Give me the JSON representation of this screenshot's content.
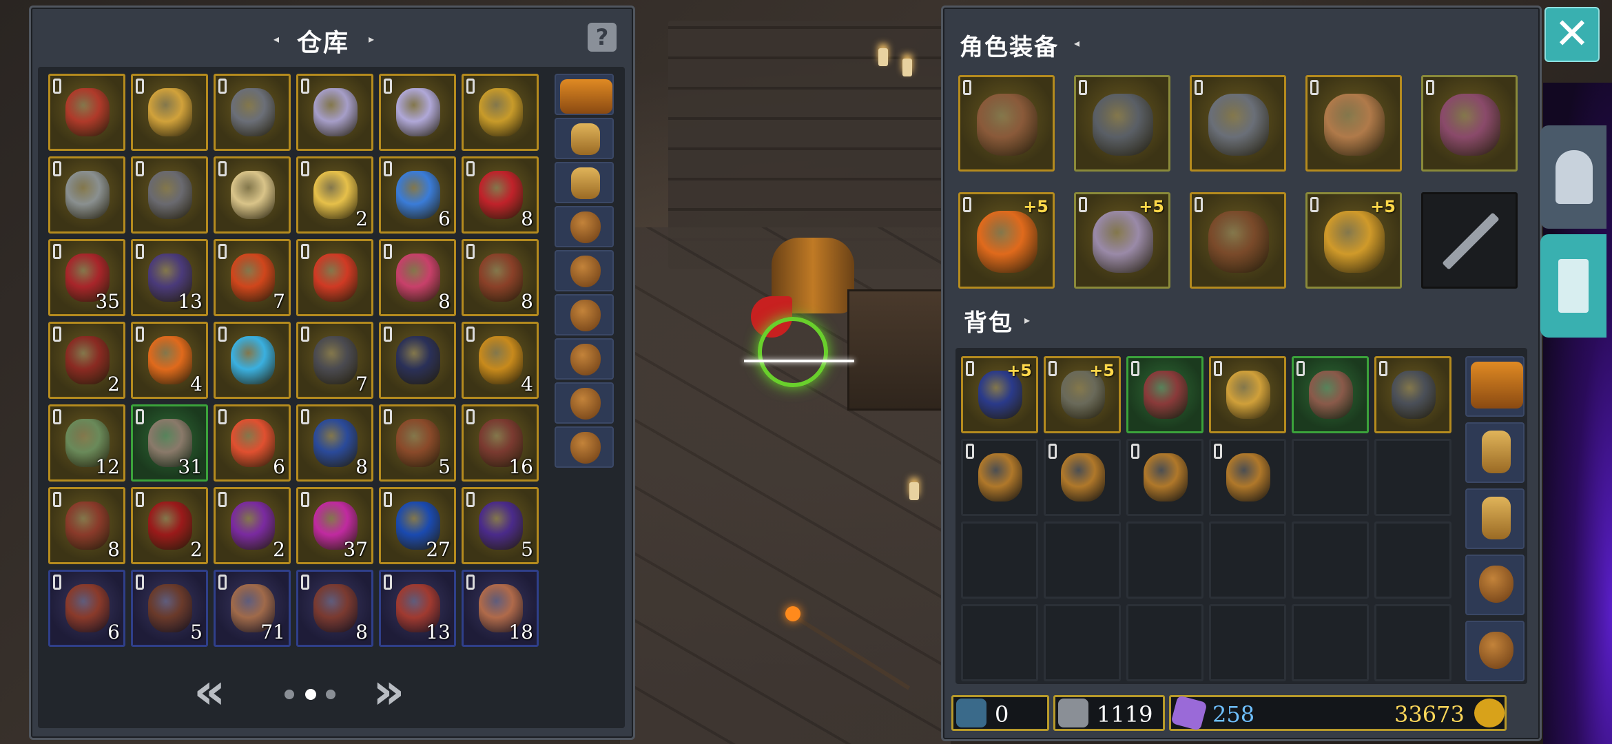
{
  "warehouse": {
    "title": "仓库",
    "help_label": "?",
    "prev_label": "«",
    "next_label": "»",
    "page_dots": 3,
    "current_page": 2,
    "grid": [
      [
        {
          "n": "",
          "c": "#b03a2a"
        },
        {
          "n": "",
          "c": "#d1a23b"
        },
        {
          "n": "",
          "c": "#6b6f78"
        },
        {
          "n": "",
          "c": "#a69ec8"
        },
        {
          "n": "",
          "c": "#b0a8d8"
        },
        {
          "n": "",
          "c": "#c89b2a"
        }
      ],
      [
        {
          "n": "",
          "c": "#8a9090"
        },
        {
          "n": "",
          "c": "#6a6a70"
        },
        {
          "n": "",
          "c": "#d9c489"
        },
        {
          "n": "2",
          "c": "#e6c04a"
        },
        {
          "n": "6",
          "c": "#3a7cd8"
        },
        {
          "n": "8",
          "c": "#c0222a"
        }
      ],
      [
        {
          "n": "35",
          "c": "#a8252a"
        },
        {
          "n": "13",
          "c": "#4a3a7a"
        },
        {
          "n": "7",
          "c": "#d0461c"
        },
        {
          "n": "",
          "c": "#d03a24"
        },
        {
          "n": "8",
          "c": "#c8406a"
        },
        {
          "n": "8",
          "c": "#8a4028"
        }
      ],
      [
        {
          "n": "2",
          "c": "#8a2a22"
        },
        {
          "n": "4",
          "c": "#e06a1c"
        },
        {
          "n": "",
          "c": "#3ab0e0"
        },
        {
          "n": "7",
          "c": "#4a4a50"
        },
        {
          "n": "",
          "c": "#2a3058"
        },
        {
          "n": "4",
          "c": "#c88a1c"
        }
      ],
      [
        {
          "n": "12",
          "c": "#6a8a5a"
        },
        {
          "n": "31",
          "c": "#8a7a6a"
        },
        {
          "n": "6",
          "c": "#e05030"
        },
        {
          "n": "8",
          "c": "#2a4a9a"
        },
        {
          "n": "5",
          "c": "#8a4a2a"
        },
        {
          "n": "16",
          "c": "#7a3a30"
        }
      ],
      [
        {
          "n": "8",
          "c": "#8a3a2a"
        },
        {
          "n": "2",
          "c": "#9a1a1a"
        },
        {
          "n": "2",
          "c": "#7a2aa0"
        },
        {
          "n": "37",
          "c": "#c02aa0"
        },
        {
          "n": "27",
          "c": "#1a4ab0"
        },
        {
          "n": "5",
          "c": "#4a2a8a"
        }
      ],
      [
        {
          "n": "6",
          "c": "#8a3a2a"
        },
        {
          "n": "5",
          "c": "#6a3a2a"
        },
        {
          "n": "71",
          "c": "#a06a4a"
        },
        {
          "n": "8",
          "c": "#7a3a30"
        },
        {
          "n": "13",
          "c": "#a03a30"
        },
        {
          "n": "18",
          "c": "#b06a4a"
        }
      ]
    ],
    "row_colors": [
      "gold",
      "gold",
      "gold",
      "gold",
      "mixed",
      "gold",
      "blue"
    ],
    "green_slots": [
      [
        4,
        1
      ]
    ]
  },
  "equipment": {
    "title": "角色装备",
    "slots": [
      {
        "plus": "",
        "c": "#8a5a3a"
      },
      {
        "plus": "",
        "c": "#5a5f66"
      },
      {
        "plus": "",
        "c": "#6a6f78"
      },
      {
        "plus": "",
        "c": "#b07a4a"
      },
      {
        "plus": "",
        "c": "#8a4a6a"
      },
      {
        "plus": "+5",
        "c": "#e06a1c"
      },
      {
        "plus": "+5",
        "c": "#9a8aa8"
      },
      {
        "plus": "",
        "c": "#7a4a2a"
      },
      {
        "plus": "+5",
        "c": "#d09a2a"
      },
      {
        "plus": "",
        "c": "#2a2a2a"
      }
    ]
  },
  "backpack": {
    "title": "背包",
    "row1": [
      {
        "plus": "+5",
        "c": "#2a3a8a",
        "border": "gold"
      },
      {
        "plus": "+5",
        "c": "#6a6a5a",
        "border": "gold"
      },
      {
        "plus": "",
        "c": "#8a3a3a",
        "border": "green"
      },
      {
        "plus": "",
        "c": "#d0a03a",
        "border": "gold"
      },
      {
        "plus": "",
        "c": "#8a5a4a",
        "border": "green"
      },
      {
        "plus": "",
        "c": "#4a4f58",
        "border": "gold"
      }
    ],
    "row2_bags": 4
  },
  "stats": {
    "attack": "0",
    "health": "1119",
    "gems": "258",
    "gold": "33673"
  },
  "close_label": "✕",
  "colors": {
    "accent": "#39b0b0",
    "gold_border": "#b58b1e",
    "green_border": "#3ba33b",
    "blue_border": "#2f3f8a",
    "gem_text": "#6fc0ff",
    "gold_text": "#ffd85a"
  }
}
